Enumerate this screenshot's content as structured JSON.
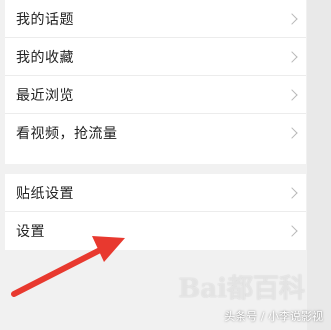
{
  "menu": {
    "group1": [
      {
        "label": "我的话题"
      },
      {
        "label": "我的收藏"
      },
      {
        "label": "最近浏览"
      },
      {
        "label": "看视频，抢流量"
      }
    ],
    "group2": [
      {
        "label": "贴纸设置"
      },
      {
        "label": "设置"
      }
    ]
  },
  "overlay": {
    "watermark": "Bai都百科",
    "source": "头条号 / 小李说影视"
  },
  "colors": {
    "arrow": "#e8392f",
    "background": "#f1f1f1"
  }
}
